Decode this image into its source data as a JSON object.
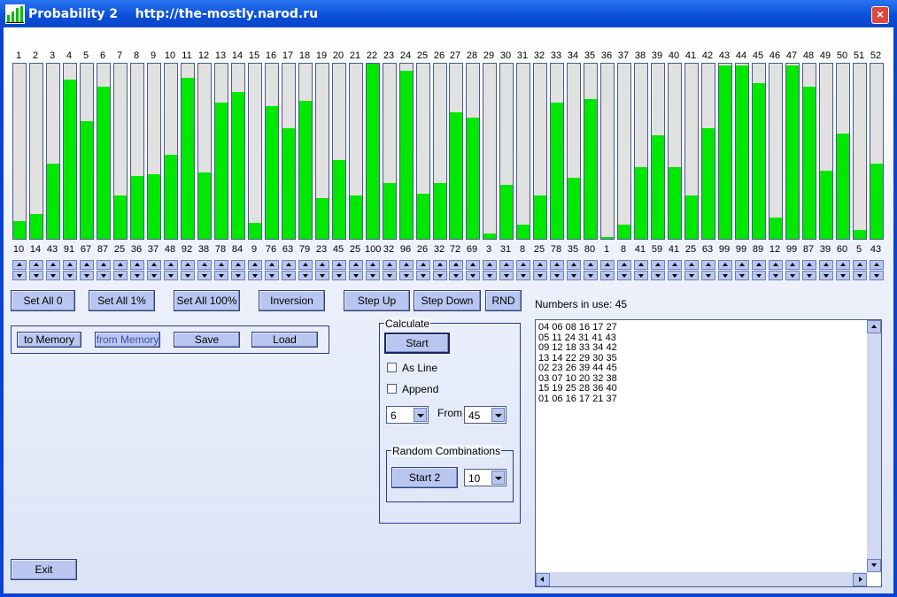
{
  "window": {
    "title": "Probability 2    http://the-mostly.narod.ru",
    "close_label": "×"
  },
  "top_numbers": [
    "1",
    "2",
    "3",
    "4",
    "5",
    "6",
    "7",
    "8",
    "9",
    "10",
    "11",
    "12",
    "13",
    "14",
    "15",
    "16",
    "17",
    "18",
    "19",
    "20",
    "21",
    "22",
    "23",
    "24",
    "25",
    "26",
    "27",
    "28",
    "29",
    "30",
    "31",
    "32",
    "33",
    "34",
    "35",
    "36",
    "37",
    "38",
    "39",
    "40",
    "41",
    "42",
    "43",
    "44",
    "45",
    "46",
    "47",
    "48",
    "49",
    "50",
    "51",
    "52"
  ],
  "values": [
    10,
    14,
    43,
    91,
    67,
    87,
    25,
    36,
    37,
    48,
    92,
    38,
    78,
    84,
    9,
    76,
    63,
    79,
    23,
    45,
    25,
    100,
    32,
    96,
    26,
    32,
    72,
    69,
    3,
    31,
    8,
    25,
    78,
    35,
    80,
    1,
    8,
    41,
    59,
    41,
    25,
    63,
    99,
    99,
    89,
    12,
    99,
    87,
    39,
    60,
    5,
    43
  ],
  "colors": {
    "fill": "#00e800",
    "empty": "#e1e1e1"
  },
  "buttons": {
    "set_all_0": "Set All 0",
    "set_all_1": "Set All 1%",
    "set_all_100": "Set All 100%",
    "inversion": "Inversion",
    "step_up": "Step Up",
    "step_down": "Step Down",
    "rnd": "RND",
    "to_memory": "to Memory",
    "from_memory": "from Memory",
    "save": "Save",
    "load": "Load",
    "exit": "Exit"
  },
  "numbers_in_use": "Numbers in use: 45",
  "calculate": {
    "group_label": "Calculate",
    "start": "Start",
    "as_line": "As Line",
    "append": "Append",
    "count_value": "6",
    "from_label": "From",
    "from_value": "45",
    "random_group_label": "Random Combinations",
    "start2": "Start 2",
    "random_count": "10"
  },
  "results": "04 06 08 16 17 27\n05 11 24 31 41 43\n09 12 18 33 34 42\n13 14 22 29 30 35\n02 23 26 39 44 45\n03 07 10 20 32 38\n15 19 25 28 36 40\n01 06 16 17 21 37"
}
